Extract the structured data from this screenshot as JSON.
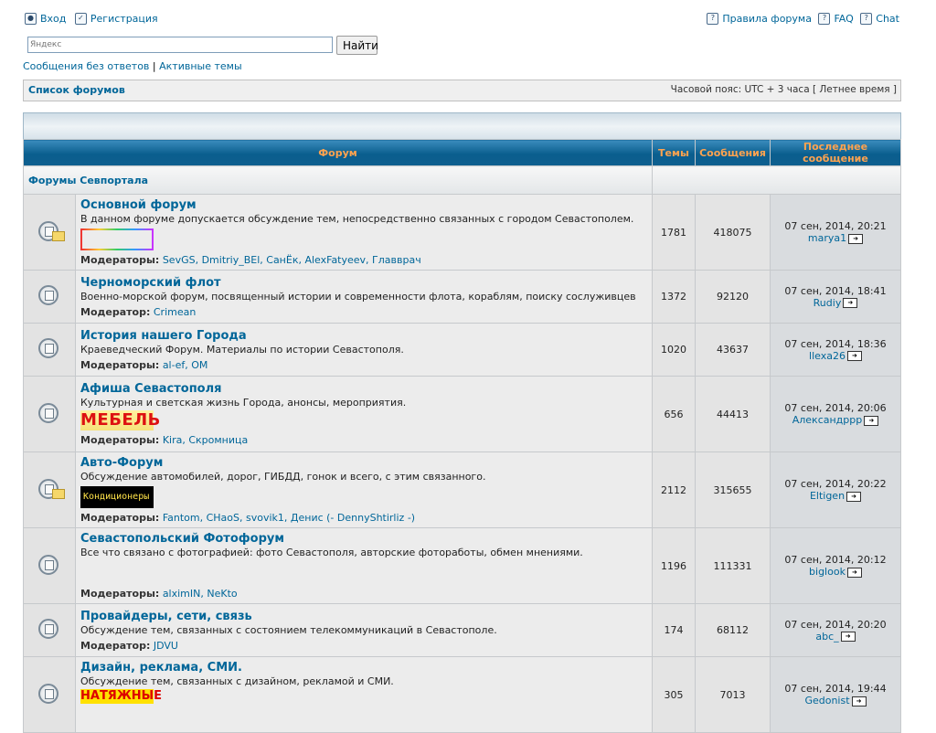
{
  "top": {
    "login": "Вход",
    "register": "Регистрация",
    "rules": "Правила форума",
    "faq": "FAQ",
    "chat": "Chat"
  },
  "search": {
    "placeholder": "Яндекс",
    "button": "Найти"
  },
  "links": {
    "unanswered": "Сообщения без ответов",
    "sep": "|",
    "active": "Активные темы"
  },
  "nav": {
    "forum_list": "Список форумов",
    "timezone": "Часовой пояс: UTC + 3 часа [ Летнее время ]"
  },
  "table": {
    "headers": {
      "forum": "Форум",
      "topics": "Темы",
      "posts": "Сообщения",
      "last": "Последнее сообщение"
    },
    "category": "Форумы Севпортала",
    "mod_label_plural": "Модераторы:",
    "mod_label_single": "Модератор:",
    "rows": [
      {
        "name": "Основной форум",
        "desc": "В данном форуме допускается обсуждение тем, непосредственно связанных с городом Севастополем.",
        "mods": "SevGS, Dmitriy_BEl, СанЁк, AlexFatyeev, Главврач",
        "topics": "1781",
        "posts": "418075",
        "last_date": "07 сен, 2014, 20:21",
        "last_user": "marya1"
      },
      {
        "name": "Черноморский флот",
        "desc": "Военно-морской форум, посвященный истории и современности флота, кораблям, поиску сослуживцев",
        "mods": "Crimean",
        "topics": "1372",
        "posts": "92120",
        "last_date": "07 сен, 2014, 18:41",
        "last_user": "Rudiy"
      },
      {
        "name": "История нашего Города",
        "desc": "Краеведческий Форум. Материалы по истории Севастополя.",
        "mods": "al-ef, OM",
        "topics": "1020",
        "posts": "43637",
        "last_date": "07 сен, 2014, 18:36",
        "last_user": "llexa26"
      },
      {
        "name": "Афиша Севастополя",
        "desc": "Культурная и светская жизнь Города, анонсы, мероприятия.",
        "ad": "МЕБЕЛЬ",
        "mods": "Kira, Скромница",
        "topics": "656",
        "posts": "44413",
        "last_date": "07 сен, 2014, 20:06",
        "last_user": "Александрpp"
      },
      {
        "name": "Авто-Форум",
        "desc": "Обсуждение автомобилей, дорог, ГИБДД, гонок и всего, с этим связанного.",
        "ad": "Кондиционеры",
        "mods": "Fantom, CHaoS, svovik1, Денис (- DennyShtirliz -)",
        "topics": "2112",
        "posts": "315655",
        "last_date": "07 сен, 2014, 20:22",
        "last_user": "Eltigen"
      },
      {
        "name": "Севастопольский Фотофорум",
        "desc": "Все что связано с фотографией: фото Севастополя, авторские фотоработы, обмен мнениями.",
        "mods": "alximIN, NeKto",
        "topics": "1196",
        "posts": "111331",
        "last_date": "07 сен, 2014, 20:12",
        "last_user": "biglook"
      },
      {
        "name": "Провайдеры, сети, связь",
        "desc": "Обсуждение тем, связанных с состоянием телекоммуникаций в Севастополе.",
        "mods": "JDVU",
        "topics": "174",
        "posts": "68112",
        "last_date": "07 сен, 2014, 20:20",
        "last_user": "abc_"
      },
      {
        "name": "Дизайн, реклама, СМИ.",
        "desc": "Обсуждение тем, связанных с дизайном, рекламой и СМИ.",
        "ad": "НАТЯЖНЫЕ",
        "topics": "305",
        "posts": "7013",
        "last_date": "07 сен, 2014, 19:44",
        "last_user": "Gedonist"
      }
    ]
  }
}
